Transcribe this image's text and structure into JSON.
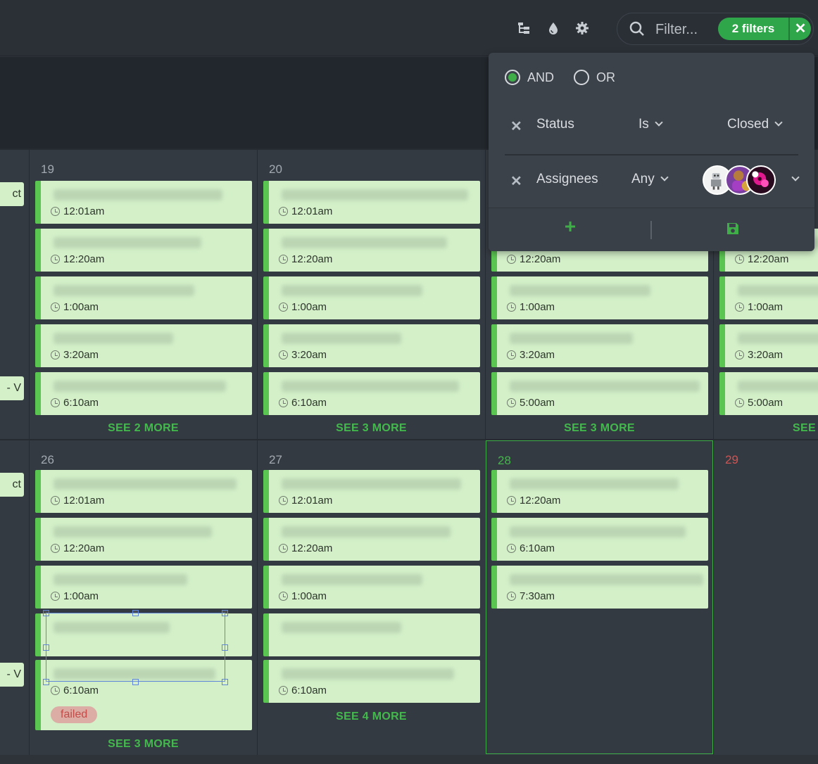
{
  "toolbar": {
    "icons": [
      "hierarchy-icon",
      "droplet-icon",
      "gear-icon",
      "search-icon"
    ],
    "filter_placeholder": "Filter...",
    "filter_pill_label": "2 filters",
    "clear_label": "✕"
  },
  "filter_panel": {
    "logic_and": "AND",
    "logic_or": "OR",
    "selected_logic": "AND",
    "rules": [
      {
        "field": "Status",
        "operator": "Is",
        "value": "Closed"
      },
      {
        "field": "Assignees",
        "operator": "Any",
        "value_avatars": [
          "robot-avatar",
          "purple-avatar",
          "magenta-flower-avatar"
        ]
      }
    ],
    "add_icon": "plus-icon",
    "save_icon": "save-icon",
    "accent": "#3fae48"
  },
  "calendar": {
    "row1": {
      "days": [
        {
          "num": "19",
          "times": [
            "12:01am",
            "12:20am",
            "1:00am",
            "3:20am",
            "6:10am"
          ],
          "see_more": "SEE 2 MORE"
        },
        {
          "num": "20",
          "times": [
            "12:01am",
            "12:20am",
            "1:00am",
            "3:20am",
            "6:10am"
          ],
          "see_more": "SEE 3 MORE"
        },
        {
          "num": "",
          "times": [
            "12:20am",
            "1:00am",
            "3:20am",
            "5:00am"
          ],
          "see_more": "SEE 3 MORE"
        },
        {
          "num": "",
          "times": [
            "12:20am",
            "1:00am",
            "3:20am",
            "5:00am"
          ],
          "see_more": "SEE"
        }
      ],
      "left_partial": [
        "ct",
        "- V"
      ]
    },
    "row2": {
      "days": [
        {
          "num": "26",
          "times": [
            "12:01am",
            "12:20am",
            "1:00am",
            "",
            "6:10am"
          ],
          "badge": "failed",
          "see_more": "SEE 3 MORE"
        },
        {
          "num": "27",
          "times": [
            "12:01am",
            "12:20am",
            "1:00am",
            "",
            "6:10am"
          ],
          "see_more": "SEE 4 MORE"
        },
        {
          "num": "28",
          "times": [
            "12:20am",
            "6:10am",
            "7:30am"
          ]
        },
        {
          "num": "29",
          "times": []
        }
      ],
      "left_partial": [
        "ct",
        "- V"
      ]
    },
    "colors": {
      "event_bg": "#d3f0c9",
      "event_bar": "#5bc552",
      "today": "#47b34f",
      "weekend": "#d05353",
      "failed": "#c44b48"
    }
  }
}
